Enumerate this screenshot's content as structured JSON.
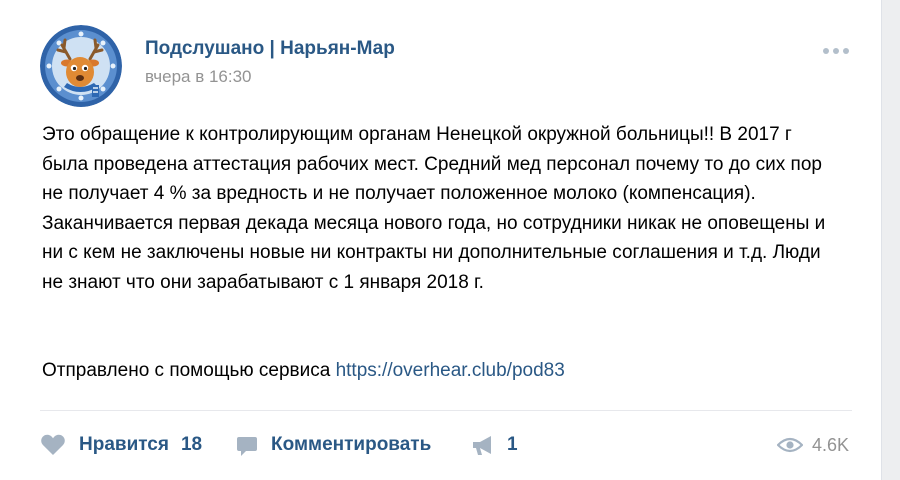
{
  "post": {
    "author": "Подслушано | Нарьян-Мар",
    "date": "вчера в 16:30",
    "text": "Это обращение к контролирующим органам Ненецкой окружной больницы!! В 2017 г была проведена аттестация рабочих мест. Средний мед персонал почему то до сих пор не получает 4 % за вредность и не получает положенное молоко (компенсация). Заканчивается первая декада месяца нового года, но сотрудники никак не оповещены и ни с кем не заключены новые ни контракты ни дополнительные соглашения и т.д. Люди не знают что они зарабатывают с 1 января 2018 г.",
    "source_prefix": "Отправлено с помощью сервиса",
    "source_link": "https://overhear.club/pod83"
  },
  "actions": {
    "like_label": "Нравится",
    "like_count": "18",
    "comment_label": "Комментировать",
    "share_count": "1",
    "views_count": "4.6K"
  },
  "icons": {
    "avatar": "reindeer-avatar",
    "more": "more-dots-icon",
    "like": "heart-icon",
    "comment": "comment-icon",
    "share": "megaphone-icon",
    "views": "eye-icon"
  },
  "colors": {
    "link": "#2a5885",
    "muted": "#939393",
    "icon": "#a5b3c2",
    "background": "#edeef0",
    "card": "#ffffff"
  }
}
